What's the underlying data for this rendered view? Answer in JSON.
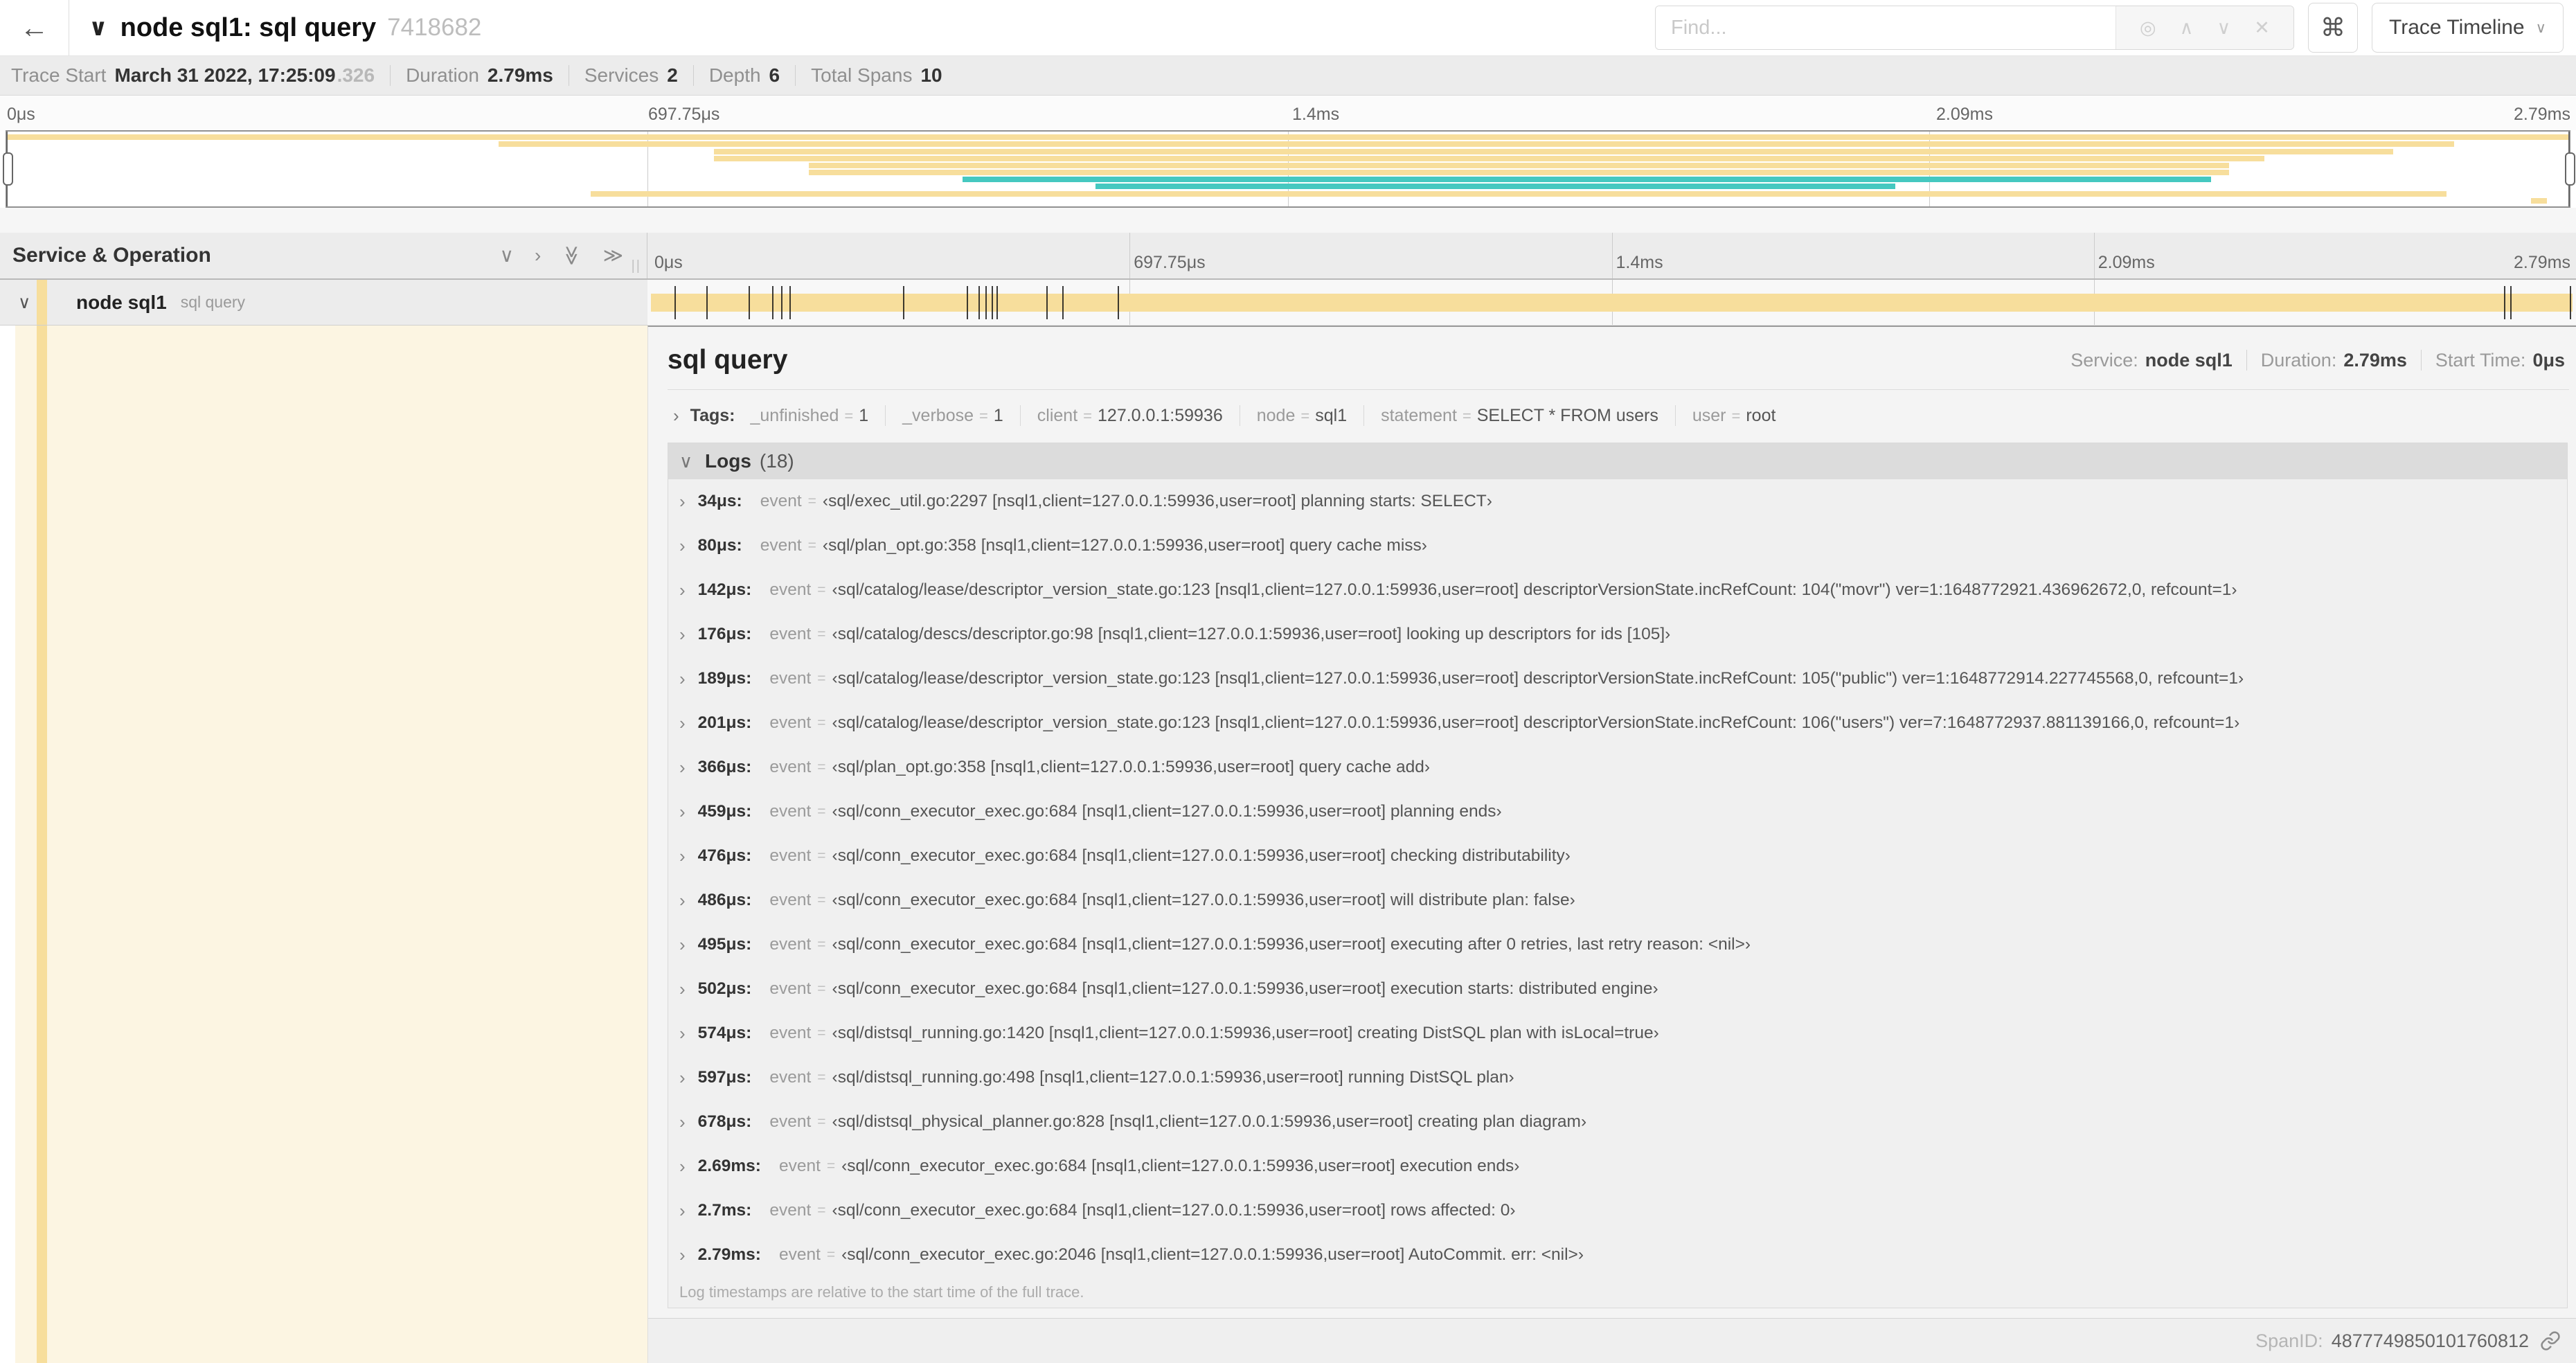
{
  "header": {
    "back_icon": "←",
    "collapse_icon": "∨",
    "title": "node sql1: sql query",
    "trace_id": "7418682",
    "find": {
      "placeholder": "Find...",
      "buttons": [
        {
          "glyph": "◎"
        },
        {
          "glyph": "∧"
        },
        {
          "glyph": "∨"
        },
        {
          "glyph": "✕"
        }
      ]
    },
    "shortcut_icon": "⌘",
    "view_select": {
      "label": "Trace Timeline",
      "chevron": "∨"
    }
  },
  "summary": {
    "items": [
      {
        "label": "Trace Start",
        "value": "March 31 2022, 17:25:09",
        "suffix": ".326"
      },
      {
        "label": "Duration",
        "value": "2.79ms"
      },
      {
        "label": "Services",
        "value": "2"
      },
      {
        "label": "Depth",
        "value": "6"
      },
      {
        "label": "Total Spans",
        "value": "10"
      }
    ]
  },
  "ruler": {
    "labels": [
      "0μs",
      "697.75μs",
      "1.4ms",
      "2.09ms",
      "2.79ms"
    ],
    "positions_pct": [
      0,
      25,
      50,
      75,
      100
    ],
    "gridlines_pct": [
      25,
      50,
      75
    ]
  },
  "colors": {
    "span_tan": "#F7DE9C",
    "span_teal": "#45C8C0",
    "selected_row_cream": "#FCF5E2"
  },
  "minimap": {
    "spans": [
      {
        "start_pct": 0,
        "end_pct": 100,
        "color": "tan"
      },
      {
        "start_pct": 19.2,
        "end_pct": 95.5,
        "color": "tan"
      },
      {
        "start_pct": 27.6,
        "end_pct": 93.1,
        "color": "tan"
      },
      {
        "start_pct": 27.6,
        "end_pct": 88.1,
        "color": "tan"
      },
      {
        "start_pct": 31.3,
        "end_pct": 86.7,
        "color": "tan"
      },
      {
        "start_pct": 31.3,
        "end_pct": 86.7,
        "color": "tan"
      },
      {
        "start_pct": 37.3,
        "end_pct": 86.0,
        "color": "teal"
      },
      {
        "start_pct": 42.5,
        "end_pct": 73.7,
        "color": "teal"
      },
      {
        "start_pct": 22.8,
        "end_pct": 95.2,
        "color": "tan"
      },
      {
        "start_pct": 98.5,
        "end_pct": 99.1,
        "color": "tan"
      }
    ]
  },
  "timeline": {
    "left_header": "Service & Operation",
    "controls": [
      {
        "glyph": "∨"
      },
      {
        "glyph": "›"
      },
      {
        "glyph": "≫"
      },
      {
        "glyph": "≫"
      }
    ],
    "column_grip": "||",
    "row": {
      "chevron": "∨",
      "service": "node sql1",
      "operation": "sql query"
    },
    "log_tick_pcts": [
      1.22,
      2.87,
      5.09,
      6.31,
      6.77,
      7.2,
      13.12,
      16.45,
      17.06,
      17.42,
      17.74,
      17.99,
      20.57,
      21.4,
      24.3,
      96.42,
      96.77,
      99.85
    ]
  },
  "detail": {
    "title": "sql query",
    "meta": [
      {
        "label": "Service:",
        "value": "node sql1"
      },
      {
        "label": "Duration:",
        "value": "2.79ms"
      },
      {
        "label": "Start Time:",
        "value": "0μs"
      }
    ],
    "tags_chevron": "›",
    "tags_label": "Tags:",
    "tags": [
      {
        "key": "_unfinished",
        "value": "1"
      },
      {
        "key": "_verbose",
        "value": "1"
      },
      {
        "key": "client",
        "value": "127.0.0.1:59936"
      },
      {
        "key": "node",
        "value": "sql1"
      },
      {
        "key": "statement",
        "value": "SELECT * FROM users"
      },
      {
        "key": "user",
        "value": "root"
      }
    ],
    "logs_chevron": "∨",
    "logs_label": "Logs",
    "logs_count": "(18)",
    "log_field": "event",
    "logs": [
      {
        "time": "34μs:",
        "value": "‹sql/exec_util.go:2297 [nsql1,client=127.0.0.1:59936,user=root] planning starts: SELECT›"
      },
      {
        "time": "80μs:",
        "value": "‹sql/plan_opt.go:358 [nsql1,client=127.0.0.1:59936,user=root] query cache miss›"
      },
      {
        "time": "142μs:",
        "value": "‹sql/catalog/lease/descriptor_version_state.go:123 [nsql1,client=127.0.0.1:59936,user=root] descriptorVersionState.incRefCount: 104(\"movr\") ver=1:1648772921.436962672,0, refcount=1›"
      },
      {
        "time": "176μs:",
        "value": "‹sql/catalog/descs/descriptor.go:98 [nsql1,client=127.0.0.1:59936,user=root] looking up descriptors for ids [105]›"
      },
      {
        "time": "189μs:",
        "value": "‹sql/catalog/lease/descriptor_version_state.go:123 [nsql1,client=127.0.0.1:59936,user=root] descriptorVersionState.incRefCount: 105(\"public\") ver=1:1648772914.227745568,0, refcount=1›"
      },
      {
        "time": "201μs:",
        "value": "‹sql/catalog/lease/descriptor_version_state.go:123 [nsql1,client=127.0.0.1:59936,user=root] descriptorVersionState.incRefCount: 106(\"users\") ver=7:1648772937.881139166,0, refcount=1›"
      },
      {
        "time": "366μs:",
        "value": "‹sql/plan_opt.go:358 [nsql1,client=127.0.0.1:59936,user=root] query cache add›"
      },
      {
        "time": "459μs:",
        "value": "‹sql/conn_executor_exec.go:684 [nsql1,client=127.0.0.1:59936,user=root] planning ends›"
      },
      {
        "time": "476μs:",
        "value": "‹sql/conn_executor_exec.go:684 [nsql1,client=127.0.0.1:59936,user=root] checking distributability›"
      },
      {
        "time": "486μs:",
        "value": "‹sql/conn_executor_exec.go:684 [nsql1,client=127.0.0.1:59936,user=root] will distribute plan: false›"
      },
      {
        "time": "495μs:",
        "value": "‹sql/conn_executor_exec.go:684 [nsql1,client=127.0.0.1:59936,user=root] executing after 0 retries, last retry reason: <nil>›"
      },
      {
        "time": "502μs:",
        "value": "‹sql/conn_executor_exec.go:684 [nsql1,client=127.0.0.1:59936,user=root] execution starts: distributed engine›"
      },
      {
        "time": "574μs:",
        "value": "‹sql/distsql_running.go:1420 [nsql1,client=127.0.0.1:59936,user=root] creating DistSQL plan with isLocal=true›"
      },
      {
        "time": "597μs:",
        "value": "‹sql/distsql_running.go:498 [nsql1,client=127.0.0.1:59936,user=root] running DistSQL plan›"
      },
      {
        "time": "678μs:",
        "value": "‹sql/distsql_physical_planner.go:828 [nsql1,client=127.0.0.1:59936,user=root] creating plan diagram›"
      },
      {
        "time": "2.69ms:",
        "value": "‹sql/conn_executor_exec.go:684 [nsql1,client=127.0.0.1:59936,user=root] execution ends›"
      },
      {
        "time": "2.7ms:",
        "value": "‹sql/conn_executor_exec.go:684 [nsql1,client=127.0.0.1:59936,user=root] rows affected: 0›"
      },
      {
        "time": "2.79ms:",
        "value": "‹sql/conn_executor_exec.go:2046 [nsql1,client=127.0.0.1:59936,user=root] AutoCommit. err: <nil>›"
      }
    ],
    "note": "Log timestamps are relative to the start time of the full trace.",
    "span_id_label": "SpanID:",
    "span_id": "4877749850101760812"
  }
}
